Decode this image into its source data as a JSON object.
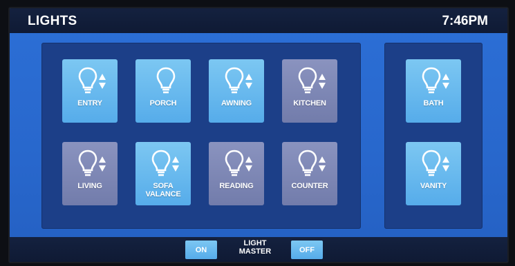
{
  "header": {
    "title": "LIGHTS",
    "time": "7:46PM"
  },
  "colors": {
    "on_tile": "#66b8ee",
    "off_tile": "#7f88b7",
    "panel": "#1c3f88",
    "screen": "#2a6ad0",
    "bar": "#111d39"
  },
  "lights": [
    {
      "label": "ENTRY",
      "state": "on",
      "icon": "bulb-icon",
      "dimmer": true
    },
    {
      "label": "PORCH",
      "state": "on",
      "icon": "bulb-icon",
      "dimmer": false
    },
    {
      "label": "AWNING",
      "state": "on",
      "icon": "bulb-icon",
      "dimmer": true
    },
    {
      "label": "KITCHEN",
      "state": "off",
      "icon": "bulb-icon",
      "dimmer": true
    },
    {
      "label": "LIVING",
      "state": "off",
      "icon": "bulb-icon",
      "dimmer": true
    },
    {
      "label": "SOFA\nVALANCE",
      "state": "on",
      "icon": "bulb-icon",
      "dimmer": true
    },
    {
      "label": "READING",
      "state": "off",
      "icon": "bulb-icon",
      "dimmer": true
    },
    {
      "label": "COUNTER",
      "state": "off",
      "icon": "bulb-icon",
      "dimmer": true
    },
    {
      "label": "BATH",
      "state": "on",
      "icon": "bulb-icon",
      "dimmer": true
    },
    {
      "label": "VANITY",
      "state": "on",
      "icon": "bulb-icon",
      "dimmer": true
    }
  ],
  "master": {
    "on_label": "ON",
    "label_line1": "LIGHT",
    "label_line2": "MASTER",
    "off_label": "OFF"
  }
}
